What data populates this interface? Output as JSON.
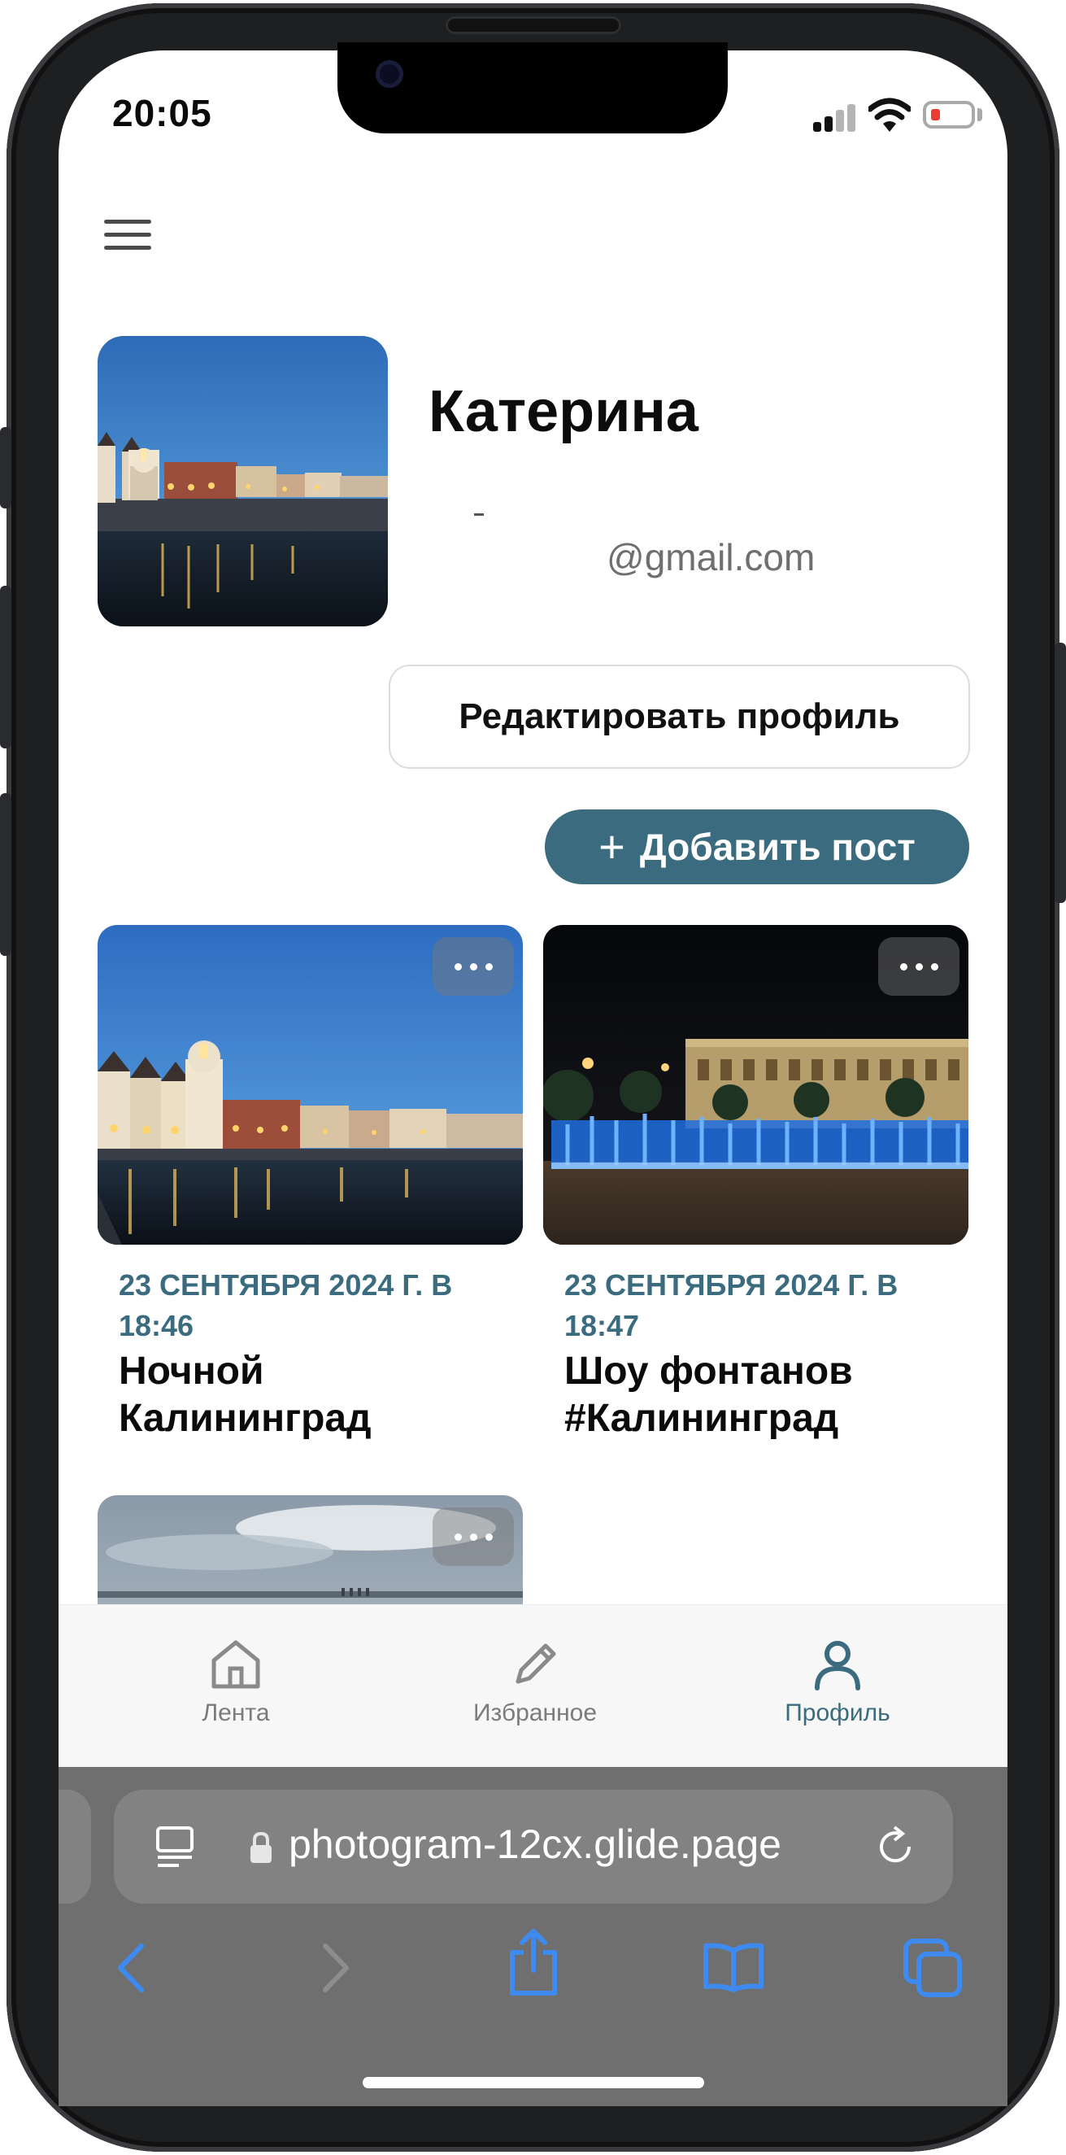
{
  "status_bar": {
    "time": "20:05"
  },
  "menu": {
    "icon": "hamburger-menu-icon"
  },
  "profile": {
    "name": "Катерина",
    "email": "@gmail.com",
    "edit_button": "Редактировать профиль",
    "add_post_button": "Добавить пост",
    "add_post_icon": "+"
  },
  "posts": [
    {
      "date": "23 СЕНТЯБРЯ 2024 Г. В 18:46",
      "title": "Ночной Калининград",
      "image": "kaliningrad-embankment-dusk"
    },
    {
      "date": "23 СЕНТЯБРЯ 2024 Г. В 18:47",
      "title": "Шоу фонтанов #Калининград",
      "image": "fountain-show-night"
    },
    {
      "date": "",
      "title": "",
      "image": "cloudy-seaside"
    }
  ],
  "tabbar": {
    "tabs": [
      {
        "label": "Лента",
        "icon": "home-icon",
        "active": false
      },
      {
        "label": "Избранное",
        "icon": "pencil-icon",
        "active": false
      },
      {
        "label": "Профиль",
        "icon": "person-icon",
        "active": true
      }
    ]
  },
  "browser": {
    "url": "photogram-12cx.glide.page",
    "toolbar": [
      "back-icon",
      "forward-icon",
      "share-icon",
      "bookmarks-icon",
      "tabs-icon"
    ]
  },
  "colors": {
    "accent": "#3b6b7f",
    "browser_bar": "#6f6f6f",
    "ios_blue": "#3d8bf0",
    "battery_low": "#ee3b32"
  }
}
